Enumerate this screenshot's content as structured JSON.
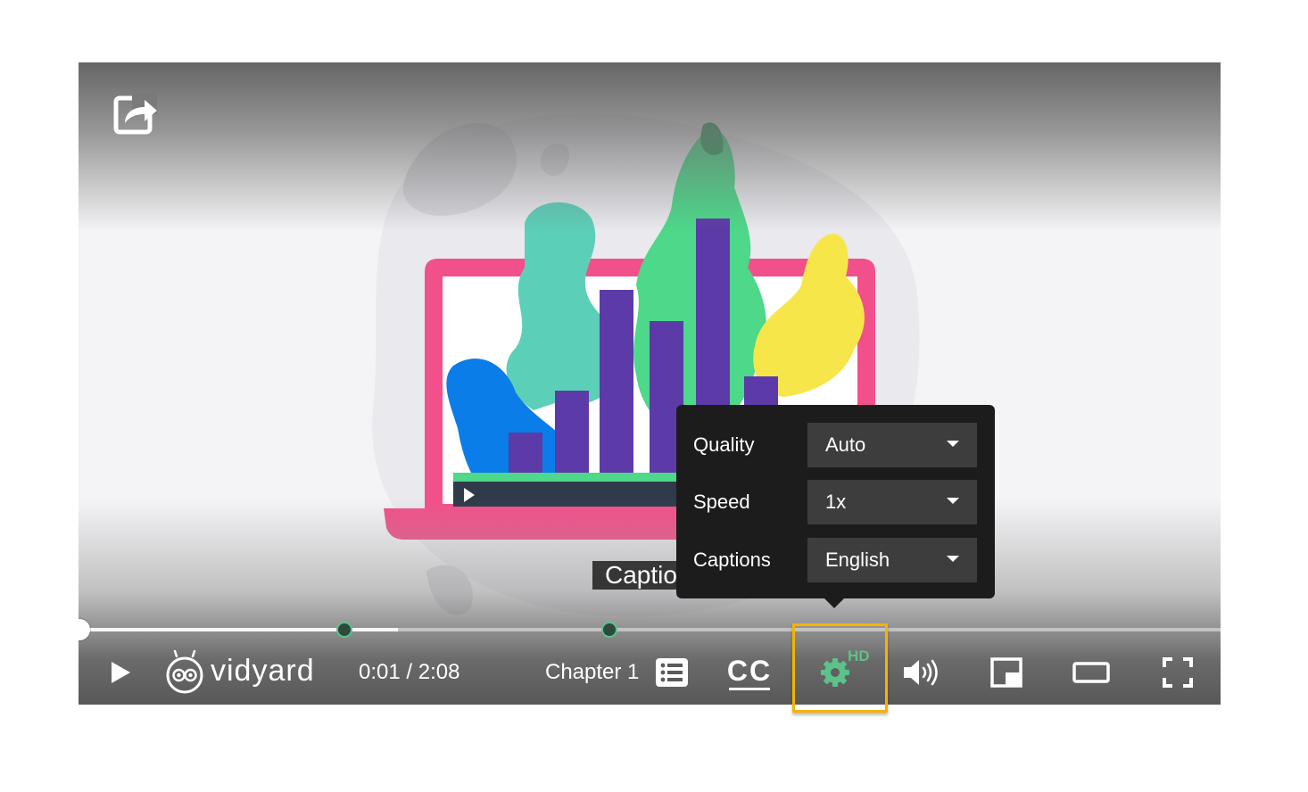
{
  "player": {
    "caption_text": "Caption",
    "time_display": "0:01 / 2:08",
    "progress_fraction": 0.0008,
    "buffer_fraction": 0.28,
    "chapter_marker_times_fraction": [
      0.2325,
      0.465
    ],
    "chapter_label": "Chapter 1",
    "brand": "vidyard",
    "cc_label": "CC",
    "hd_badge": "HD"
  },
  "settings": {
    "quality_label": "Quality",
    "quality_value": "Auto",
    "speed_label": "Speed",
    "speed_value": "1x",
    "captions_label": "Captions",
    "captions_value": "English"
  },
  "icons": {
    "share": "share-icon",
    "play": "play-icon",
    "logo": "vidyard-logo",
    "chapters": "chapter-list-icon",
    "settings": "gear-icon",
    "volume": "volume-icon",
    "pip": "picture-in-picture-icon",
    "theater": "theater-mode-icon",
    "fullscreen": "fullscreen-icon"
  },
  "colors": {
    "accent_green": "#5cc28a",
    "highlight": "#f4b400",
    "menu_bg": "#1c1c1c"
  }
}
